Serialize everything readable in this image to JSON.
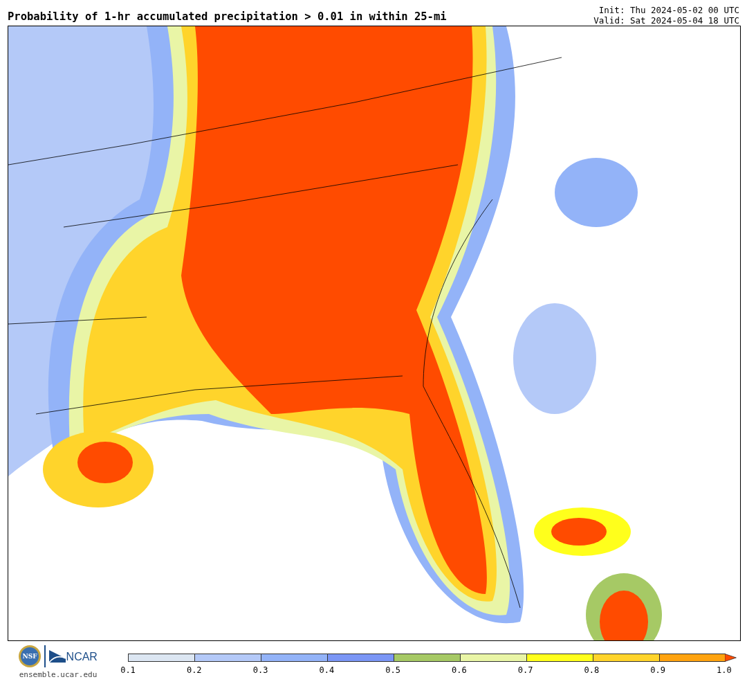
{
  "header": {
    "title": "Probability of 1-hr accumulated precipitation > 0.01 in within 25-mi",
    "init": "Init: Thu 2024-05-02 00 UTC",
    "valid": "Valid: Sat 2024-05-04 18 UTC"
  },
  "footer": {
    "logos": [
      {
        "kind": "seal",
        "text": "NSF"
      },
      {
        "kind": "wordmark",
        "text": "NCAR"
      }
    ],
    "url": "ensemble.ucar.edu"
  },
  "colorbar": {
    "segments": [
      {
        "color": "#dce6f2"
      },
      {
        "color": "#b4c9f8"
      },
      {
        "color": "#93b3f8"
      },
      {
        "color": "#7b96f5"
      },
      {
        "color": "#a6c965"
      },
      {
        "color": "#e9f5a6"
      },
      {
        "color": "#ffff1c"
      },
      {
        "color": "#ffd42b"
      },
      {
        "color": "#ffa30f"
      }
    ],
    "extend": {
      "color": "#ff4b00"
    },
    "ticks": [
      "0.1",
      "0.2",
      "0.3",
      "0.4",
      "0.5",
      "0.6",
      "0.7",
      "0.8",
      "0.9",
      "1.0"
    ]
  }
}
